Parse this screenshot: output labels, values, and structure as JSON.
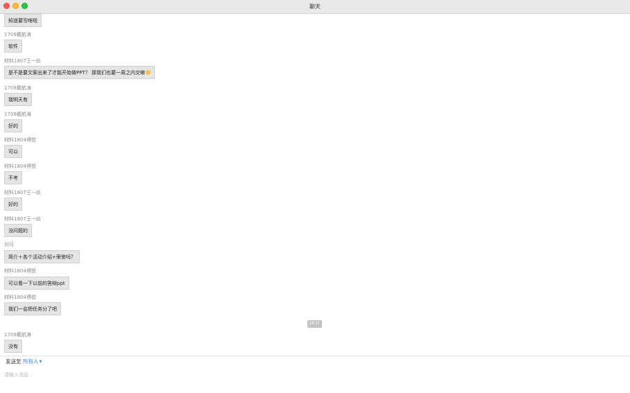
{
  "window": {
    "title": "聊天"
  },
  "messages": [
    {
      "sender": "",
      "text": "知道要写啥啦"
    },
    {
      "sender": "1709戴航涛",
      "text": "软件"
    },
    {
      "sender": "材料1807王一玖",
      "text": "是不是要文案出来了才能开始做PPT？ 那我们也要一周之内交嘛",
      "emoji": "grinning-emoji"
    },
    {
      "sender": "1709戴航涛",
      "text": "我明天有"
    },
    {
      "sender": "1709戴航涛",
      "text": "好的"
    },
    {
      "sender": "材料1804傅悦",
      "text": "可以"
    },
    {
      "sender": "材料1804傅悦",
      "text": "不考"
    },
    {
      "sender": "材料1807王一玖",
      "text": "好的"
    },
    {
      "sender": "材料1807王一玖",
      "text": "没问题的"
    },
    {
      "sender": "刘可",
      "text": "简介＋各个活动介绍+荣誉吗？"
    },
    {
      "sender": "材料1804傅悦",
      "text": "可以看一下以前的答辩ppt"
    },
    {
      "sender": "材料1804傅悦",
      "text": "我们一会把任务分了吧"
    },
    {
      "sender": "1709戴航涛",
      "text": "没有"
    }
  ],
  "timestamp": "16:17",
  "composer": {
    "send_to_label": "发送至",
    "recipient": "所有人",
    "placeholder": "请输入消息..."
  }
}
